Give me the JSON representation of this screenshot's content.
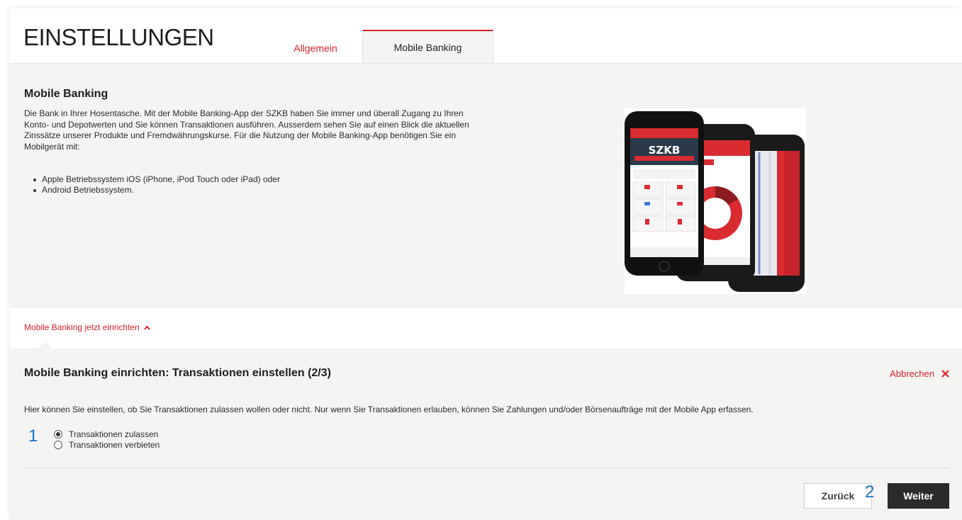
{
  "page": {
    "title": "EINSTELLUNGEN"
  },
  "tabs": [
    {
      "label": "Allgemein"
    },
    {
      "label": "Mobile Banking"
    }
  ],
  "info": {
    "title": "Mobile Banking",
    "text": "Die Bank in Ihrer Hosentasche. Mit der Mobile Banking-App der SZKB haben Sie immer und überall Zugang zu Ihren Konto- und Depotwerten und Sie können Transaktionen ausführen. Ausserdem sehen Sie auf einen Blick die aktuellen Zinssätze unserer Produkte und Fremdwährungskurse. Für die Nutzung der Mobile Banking-App benötigen Sie ein Mobilgerät mit:",
    "bullets": [
      "Apple Betriebssystem iOS (iPhone, iPod Touch oder iPad) oder",
      "Android Betriebssystem."
    ],
    "phone_brand": "SZKB"
  },
  "setup_link": {
    "label": "Mobile Banking jetzt einrichten"
  },
  "setup": {
    "title": "Mobile Banking einrichten: Transaktionen einstellen (2/3)",
    "cancel_label": "Abbrechen",
    "description": "Hier können Sie einstellen, ob Sie Transaktionen zulassen wollen oder nicht. Nur wenn Sie Transaktionen erlauben, können Sie Zahlungen und/oder Börsenaufträge mit der Mobile App erfassen.",
    "options": [
      {
        "label": "Transaktionen zulassen",
        "selected": true
      },
      {
        "label": "Transaktionen verbieten",
        "selected": false
      }
    ],
    "back_label": "Zurück",
    "next_label": "Weiter"
  },
  "markers": {
    "first": "1",
    "second": "2"
  },
  "colors": {
    "accent": "#d6222a",
    "panel": "#f4f4f3",
    "marker": "#1a73c8",
    "button_dark": "#2b2b2b"
  },
  "icons": {
    "expand": "chevron-up-icon",
    "cancel": "close-icon",
    "radio": "radio-icon"
  }
}
